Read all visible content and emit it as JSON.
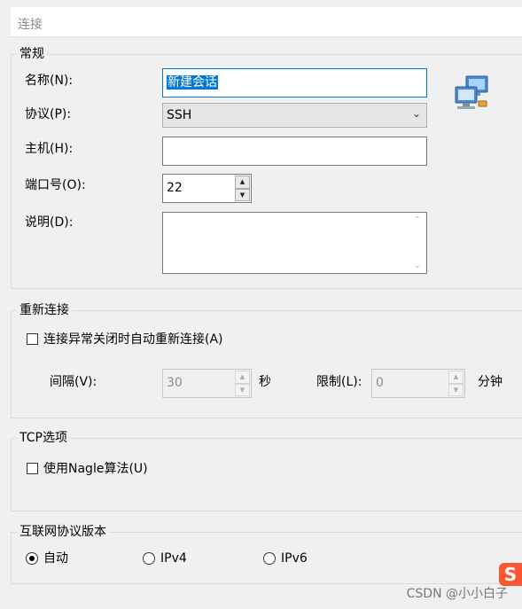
{
  "header": {
    "title": "连接"
  },
  "general": {
    "title": "常规",
    "name_label": "名称(N):",
    "name_value": "新建会话",
    "protocol_label": "协议(P):",
    "protocol_value": "SSH",
    "host_label": "主机(H):",
    "host_value": "",
    "port_label": "端口号(O):",
    "port_value": "22",
    "desc_label": "说明(D):",
    "desc_value": ""
  },
  "reconnect": {
    "title": "重新连接",
    "auto_label": "连接异常关闭时自动重新连接(A)",
    "auto_checked": false,
    "interval_label": "间隔(V):",
    "interval_value": "30",
    "interval_unit": "秒",
    "limit_label": "限制(L):",
    "limit_value": "0",
    "limit_unit": "分钟"
  },
  "tcp": {
    "title": "TCP选项",
    "nagle_label": "使用Nagle算法(U)",
    "nagle_checked": false
  },
  "ipver": {
    "title": "互联网协议版本",
    "options": [
      {
        "label": "自动",
        "checked": true
      },
      {
        "label": "IPv4",
        "checked": false
      },
      {
        "label": "IPv6",
        "checked": false
      }
    ]
  },
  "watermark": {
    "text": "CSDN @小小白子",
    "logo": "S"
  },
  "colors": {
    "accent": "#0078d7",
    "logo": "#fc5531"
  }
}
